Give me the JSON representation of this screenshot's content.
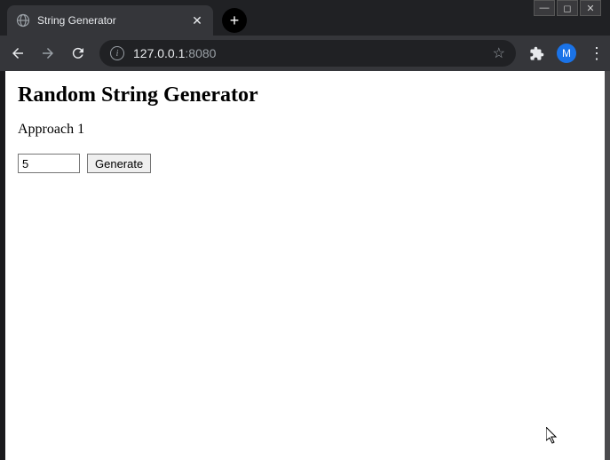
{
  "window": {
    "minimize": "—",
    "maximize": "◻",
    "close": "✕"
  },
  "browser": {
    "tab": {
      "title": "String Generator",
      "close": "✕"
    },
    "new_tab": "+",
    "nav": {
      "back": "←",
      "forward": "→",
      "reload": "⟳"
    },
    "address": {
      "info": "i",
      "host": "127.0.0.1",
      "port": ":8080",
      "star": "☆"
    },
    "profile": "M",
    "menu": "⋮"
  },
  "page": {
    "heading": "Random String Generator",
    "subheading": "Approach 1",
    "input_value": "5",
    "button_label": "Generate"
  }
}
